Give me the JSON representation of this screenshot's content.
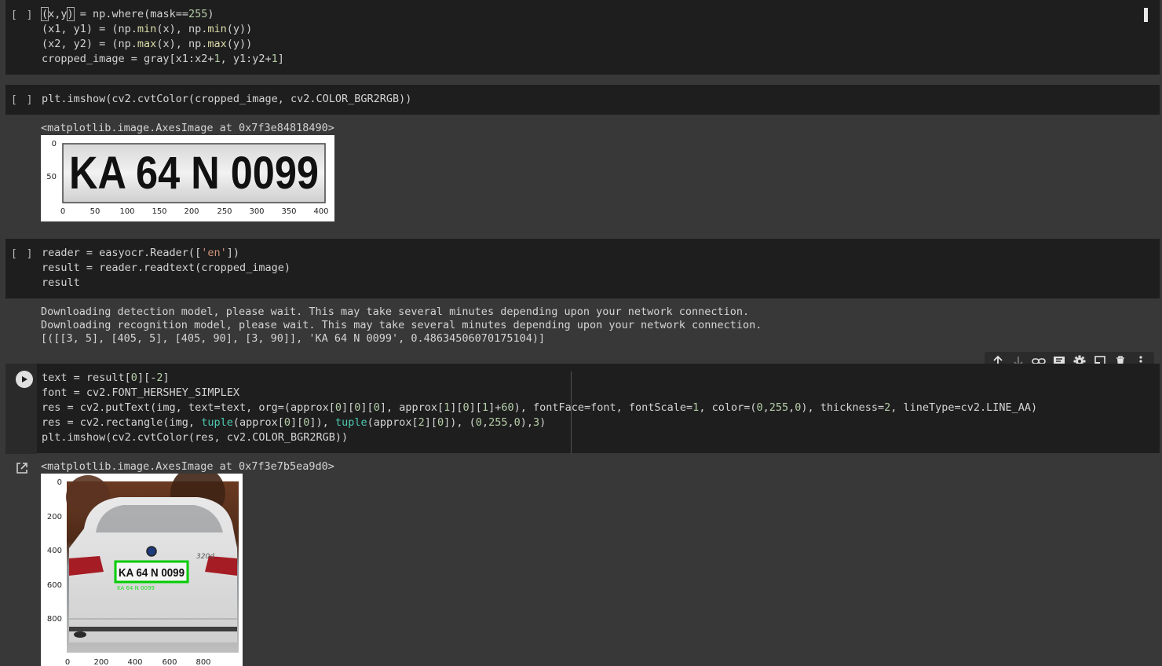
{
  "cells": [
    {
      "exec_count": "[ ]",
      "lines": [
        "(x,y) = np.where(mask==255)",
        "(x1, y1) = (np.min(x), np.min(y))",
        "(x2, y2) = (np.max(x), np.max(y))",
        "cropped_image = gray[x1:x2+1, y1:y2+1]"
      ]
    },
    {
      "exec_count": "[ ]",
      "lines": [
        "plt.imshow(cv2.cvtColor(cropped_image, cv2.COLOR_BGR2RGB))"
      ],
      "output_text": "<matplotlib.image.AxesImage at 0x7f3e84818490>",
      "plot": {
        "plate_text": "KA 64 N 0099",
        "y_ticks": [
          "0",
          "50"
        ],
        "x_ticks": [
          "0",
          "50",
          "100",
          "150",
          "200",
          "250",
          "300",
          "350",
          "400"
        ]
      }
    },
    {
      "exec_count": "[ ]",
      "lines": [
        "reader = easyocr.Reader(['en'])",
        "result = reader.readtext(cropped_image)",
        "result"
      ],
      "output_lines": [
        "Downloading detection model, please wait. This may take several minutes depending upon your network connection.",
        "Downloading recognition model, please wait. This may take several minutes depending upon your network connection.",
        "[([[3, 5], [405, 5], [405, 90], [3, 90]], 'KA 64 N 0099', 0.48634506070175104)]"
      ]
    },
    {
      "lines": [
        "text = result[0][-2]",
        "font = cv2.FONT_HERSHEY_SIMPLEX",
        "res = cv2.putText(img, text=text, org=(approx[0][0][0], approx[1][0][1]+60), fontFace=font, fontScale=1, color=(0,255,0), thickness=2, lineType=cv2.LINE_AA)",
        "res = cv2.rectangle(img, tuple(approx[0][0]), tuple(approx[2][0]), (0,255,0),3)",
        "plt.imshow(cv2.cvtColor(res, cv2.COLOR_BGR2RGB))"
      ],
      "output_text": "<matplotlib.image.AxesImage at 0x7f3e7b5ea9d0>",
      "plot": {
        "plate_text": "KA 64 N 0099",
        "overlay_text": "KA 64 N 0099",
        "badge_text": "320d",
        "y_ticks": [
          "0",
          "200",
          "400",
          "600",
          "800"
        ],
        "x_ticks": [
          "0",
          "200",
          "400",
          "600",
          "800"
        ]
      }
    }
  ],
  "toolbar": {
    "icons": [
      "arrow-up-icon",
      "arrow-down-icon",
      "link-icon",
      "comment-icon",
      "gear-icon",
      "mirror-cell-icon",
      "trash-icon",
      "more-vert-icon"
    ]
  },
  "colors": {
    "background": "#383838",
    "cell_bg": "#1e1e1e",
    "text": "#d4d4d4",
    "number": "#b5cea8",
    "string": "#ce9178",
    "builtin": "#4ec9b0",
    "plate_box": "#00ff00"
  }
}
